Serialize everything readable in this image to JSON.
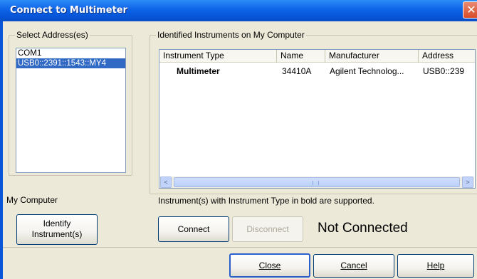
{
  "window": {
    "title": "Connect to Multimeter",
    "close_glyph": "✕"
  },
  "address_group": {
    "legend": "Select Address(es)",
    "items": [
      {
        "label": "COM1",
        "selected": false
      },
      {
        "label": "USB0::2391::1543::MY4",
        "selected": true
      }
    ],
    "footer_label": "My Computer",
    "identify_button": [
      "Identify",
      "Instrument(s)"
    ]
  },
  "instruments_group": {
    "legend": "Identified Instruments on My Computer",
    "columns": [
      "Instrument Type",
      "Name",
      "Manufacturer",
      "Address"
    ],
    "rows": [
      {
        "type": "Multimeter",
        "name": "34410A",
        "manufacturer": "Agilent Technolog...",
        "address": "USB0::239"
      }
    ],
    "scroll_left": "<",
    "scroll_right": ">",
    "note": "Instrument(s) with Instrument Type in bold are supported."
  },
  "actions": {
    "connect": "Connect",
    "disconnect": "Disconnect",
    "status": "Not Connected"
  },
  "footer": {
    "close": "Close",
    "cancel": "Cancel",
    "help": "Help"
  }
}
